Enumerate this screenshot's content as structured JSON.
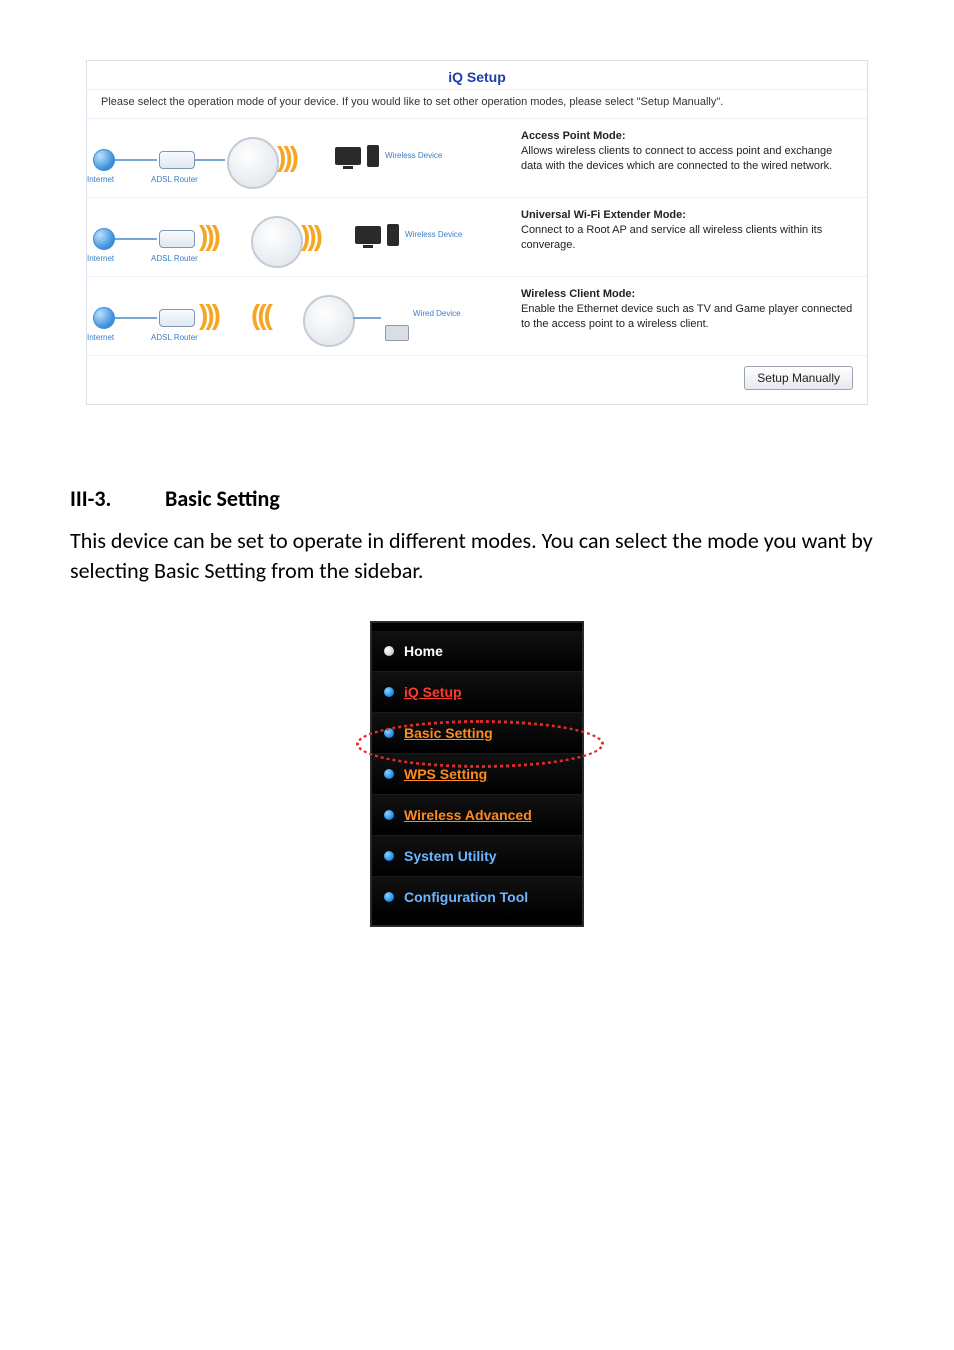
{
  "iq_panel": {
    "title": "iQ Setup",
    "intro": "Please select the operation mode of your device. If you would like to set other operation modes, please select \"Setup Manually\".",
    "diagram_labels": {
      "internet": "Internet",
      "adsl": "ADSL Router",
      "wireless_device": "Wireless Device",
      "wired_device": "Wired  Device"
    },
    "modes": [
      {
        "title": "Access Point Mode:",
        "desc": "Allows wireless clients to connect to access point and exchange data with the devices which are connected to the wired network."
      },
      {
        "title": "Universal Wi-Fi Extender Mode:",
        "desc": "Connect to a Root AP and service all wireless clients within its converage."
      },
      {
        "title": "Wireless Client Mode:",
        "desc": "Enable the Ethernet device such as TV and Game player connected to the access point to a wireless client."
      }
    ],
    "button": "Setup Manually"
  },
  "section": {
    "number": "III-3.",
    "title": "Basic Setting",
    "body": "This device can be set to operate in different modes. You can select the mode you want by selecting Basic Setting from the sidebar."
  },
  "sidebar": {
    "items": [
      {
        "label": "Home",
        "cls": "sb-home",
        "bullet": "white"
      },
      {
        "label": "iQ Setup",
        "cls": "sb-red",
        "bullet": "blue"
      },
      {
        "label": "Basic Setting",
        "cls": "sb-orange",
        "bullet": "blue"
      },
      {
        "label": "WPS Setting",
        "cls": "sb-orange",
        "bullet": "blue"
      },
      {
        "label": "Wireless Advanced",
        "cls": "sb-orange",
        "bullet": "blue"
      },
      {
        "label": "System Utility",
        "cls": "sb-blue",
        "bullet": "blue"
      },
      {
        "label": "Configuration Tool",
        "cls": "sb-blue",
        "bullet": "blue"
      }
    ]
  }
}
